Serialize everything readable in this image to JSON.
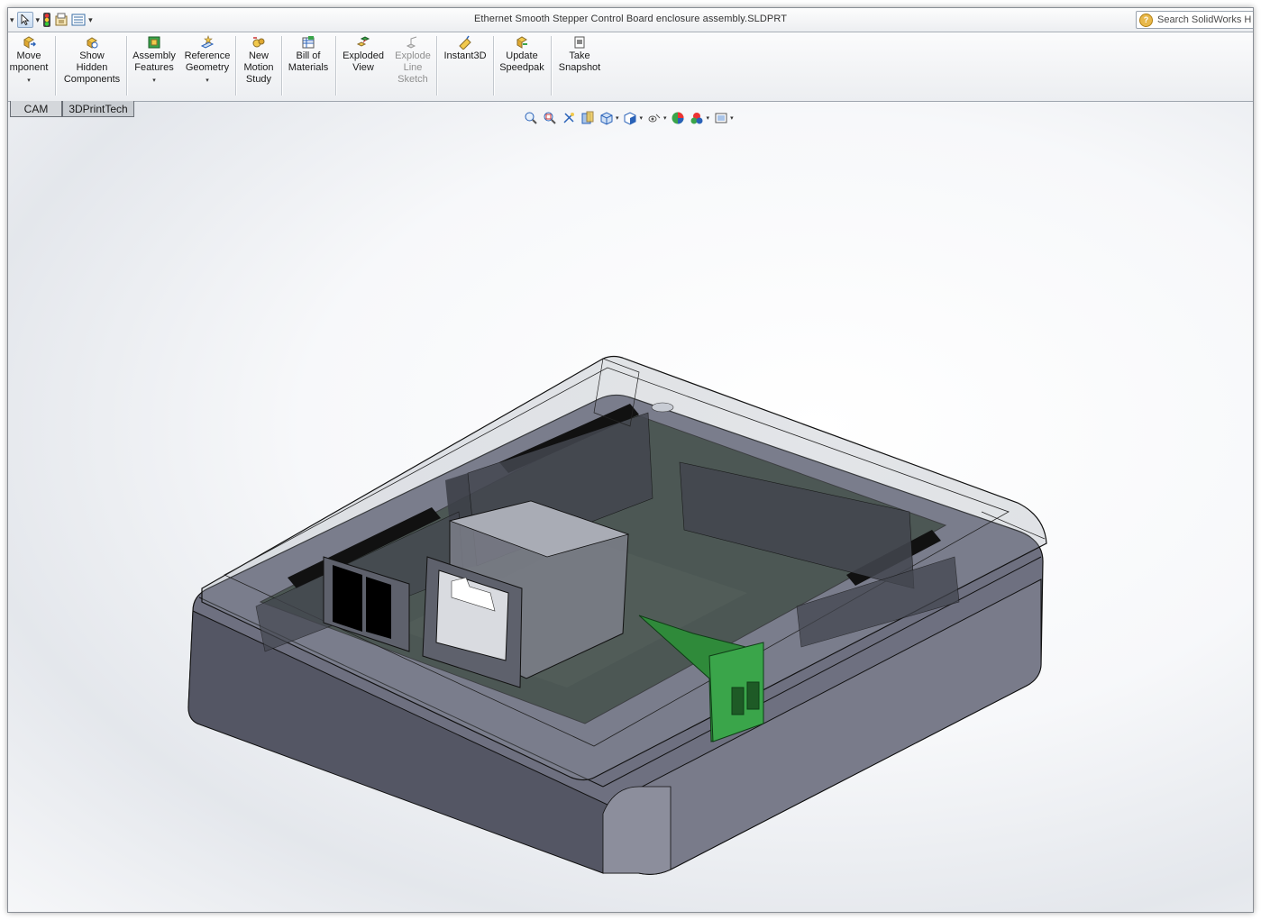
{
  "window": {
    "title": "Ethernet Smooth Stepper Control Board enclosure assembly.SLDPRT",
    "search_placeholder": "Search SolidWorks H"
  },
  "quick_access": {
    "icons": [
      "dropdown-arrow",
      "select-arrow-icon",
      "traffic-light-icon",
      "options-icon",
      "view-list-icon"
    ]
  },
  "command_manager": {
    "buttons": [
      {
        "label": "Move\nmponent",
        "icon": "move-component-icon",
        "has_dropdown": true,
        "enabled": true
      },
      {
        "label": "Show\nHidden\nComponents",
        "icon": "show-hidden-icon",
        "has_dropdown": false,
        "enabled": true
      },
      {
        "label": "Assembly\nFeatures",
        "icon": "assembly-features-icon",
        "has_dropdown": true,
        "enabled": true
      },
      {
        "label": "Reference\nGeometry",
        "icon": "reference-geometry-icon",
        "has_dropdown": true,
        "enabled": true
      },
      {
        "label": "New\nMotion\nStudy",
        "icon": "motion-study-icon",
        "has_dropdown": false,
        "enabled": true
      },
      {
        "label": "Bill of\nMaterials",
        "icon": "bill-of-materials-icon",
        "has_dropdown": false,
        "enabled": true
      },
      {
        "label": "Exploded\nView",
        "icon": "exploded-view-icon",
        "has_dropdown": false,
        "enabled": true
      },
      {
        "label": "Explode\nLine\nSketch",
        "icon": "explode-line-sketch-icon",
        "has_dropdown": false,
        "enabled": false
      },
      {
        "label": "Instant3D",
        "icon": "instant3d-icon",
        "has_dropdown": false,
        "enabled": true
      },
      {
        "label": "Update\nSpeedpak",
        "icon": "update-speedpak-icon",
        "has_dropdown": false,
        "enabled": true
      },
      {
        "label": "Take\nSnapshot",
        "icon": "take-snapshot-icon",
        "has_dropdown": false,
        "enabled": true
      }
    ]
  },
  "tabs": [
    "CAM",
    "3DPrintTech"
  ],
  "heads_up_toolbar": {
    "icons": [
      "zoom-to-fit-icon",
      "zoom-to-area-icon",
      "previous-view-icon",
      "section-view-icon",
      "view-orientation-icon",
      "display-style-icon",
      "hide-show-items-icon",
      "edit-appearance-icon",
      "apply-scene-icon",
      "view-settings-icon"
    ]
  },
  "colors": {
    "enclosure": "#6e7080",
    "enclosure_dark": "#4a4c58",
    "pcb": "#2f3b33",
    "connector_green": "#2f8a3a",
    "titlebar": "#eef0f3"
  }
}
